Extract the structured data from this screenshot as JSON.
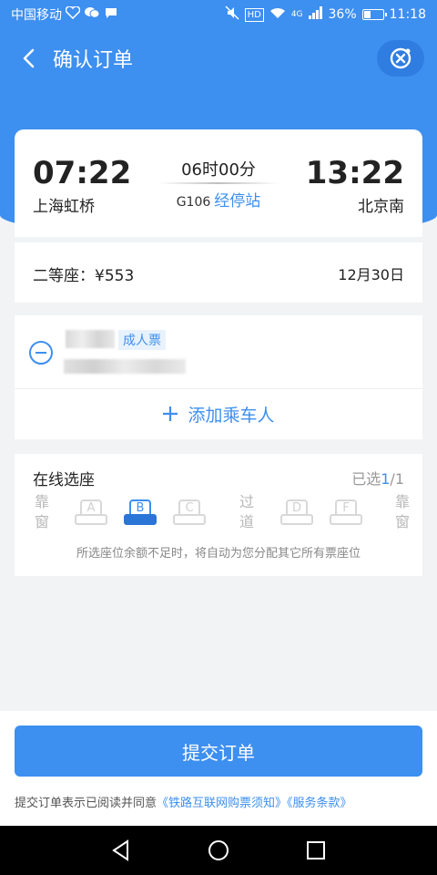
{
  "status_bar": {
    "carrier": "中国移动",
    "battery": "36%",
    "battery_level": 0.36,
    "time": "11:18",
    "hd_badge": "HD",
    "network": "4G"
  },
  "header": {
    "title": "确认订单",
    "back_icon": "chevron-left-icon",
    "close_icon": "target-close-icon"
  },
  "train": {
    "depart_time": "07:22",
    "depart_station": "上海虹桥",
    "arrive_time": "13:22",
    "arrive_station": "北京南",
    "duration": "06时00分",
    "train_no": "G106",
    "stops_link": "经停站"
  },
  "seat_info": {
    "seat_class": "二等座：¥553",
    "date": "12月30日"
  },
  "passenger": {
    "ticket_type": "成人票",
    "add_label": "添加乘车人"
  },
  "seat_select": {
    "title": "在线选座",
    "selected_prefix": "已选",
    "selected_num": "1",
    "selected_total": "/1",
    "window_left": "靠窗",
    "aisle": "过道",
    "window_right": "靠窗",
    "seats": [
      "A",
      "B",
      "C",
      "D",
      "F"
    ],
    "selected_seat": "B",
    "note": "所选座位余额不足时，将自动为您分配其它所有票座位"
  },
  "footer": {
    "submit_label": "提交订单",
    "agreement_prefix": "提交订单表示已阅读并同意",
    "link1": "《铁路互联网购票须知》",
    "link2": "《服务条款》"
  },
  "colors": {
    "primary": "#3d8ff0",
    "background": "#f2f3f5"
  }
}
